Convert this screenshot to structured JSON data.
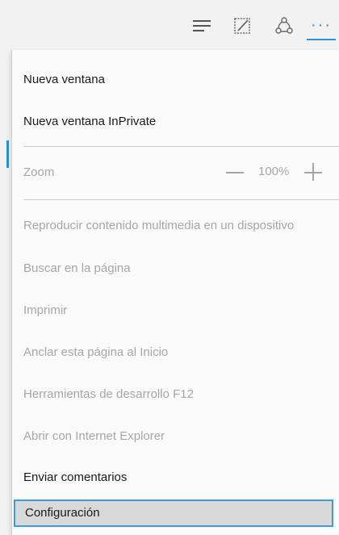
{
  "toolbar": {
    "icons": [
      "hub-icon",
      "web-note-icon",
      "share-icon"
    ],
    "more_label": "···"
  },
  "menu": {
    "new_window": "Nueva ventana",
    "new_inprivate": "Nueva ventana InPrivate",
    "zoom": {
      "label": "Zoom",
      "value": "100%"
    },
    "cast_media": "Reproducir contenido multimedia en un dispositivo",
    "find": "Buscar en la página",
    "print": "Imprimir",
    "pin": "Anclar esta página al Inicio",
    "devtools": "Herramientas de desarrollo F12",
    "open_ie": "Abrir con Internet Explorer",
    "feedback": "Enviar comentarios",
    "settings": "Configuración"
  },
  "colors": {
    "accent": "#2f8fd8",
    "text_enabled": "#1a1a1a",
    "text_disabled": "#a6a6a6",
    "selected_bg": "#d9d9d9"
  }
}
